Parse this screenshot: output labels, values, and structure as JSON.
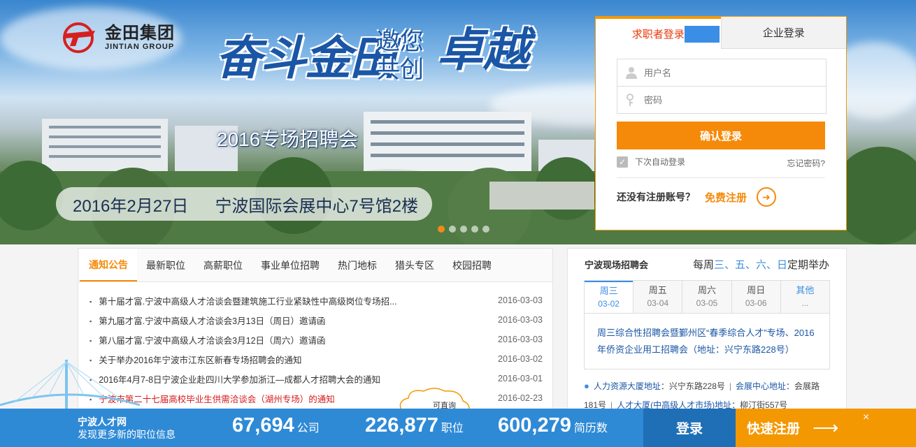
{
  "banner": {
    "logo_cn": "金田集团",
    "logo_en": "JINTIAN GROUP",
    "slogan_big": "奋斗金田",
    "slogan_line1": "邀您",
    "slogan_line2": "共创",
    "slogan_zy": "卓越",
    "fair_title": "2016专场招聘会",
    "date": "2016年2月27日",
    "venue": "宁波国际会展中心7号馆2楼"
  },
  "login": {
    "tab_seeker": "求职者登录",
    "tab_company": "企业登录",
    "username_placeholder": "用户名",
    "password_placeholder": "密码",
    "submit": "确认登录",
    "remember": "下次自动登录",
    "forgot": "忘记密码?",
    "no_account": "还没有注册账号？",
    "free_register": "免费注册"
  },
  "notice": {
    "tabs": [
      "通知公告",
      "最新职位",
      "高薪职位",
      "事业单位招聘",
      "热门地标",
      "猎头专区",
      "校园招聘"
    ],
    "items": [
      {
        "title": "第十届才富.宁波中高级人才洽谈会暨建筑施工行业紧缺性中高级岗位专场招...",
        "date": "2016-03-03"
      },
      {
        "title": "第九届才富.宁波中高级人才洽谈会3月13日（周日）邀请函",
        "date": "2016-03-03"
      },
      {
        "title": "第八届才富.宁波中高级人才洽谈会3月12日（周六）邀请函",
        "date": "2016-03-03"
      },
      {
        "title": "关于举办2016年宁波市江东区新春专场招聘会的通知",
        "date": "2016-03-02"
      },
      {
        "title": "2016年4月7-8日宁波企业赴四川大学参加浙江—成都人才招聘大会的通知",
        "date": "2016-03-01"
      },
      {
        "title": "宁波市第二十七届高校毕业生供需洽谈会（湖州专场）的通知",
        "date": "2016-02-23"
      }
    ],
    "bubble": "可直询"
  },
  "fair": {
    "title": "宁波现场招聘会",
    "schedule_prefix": "每周",
    "schedule_days": "三、五、六、日",
    "schedule_suffix": "定期举办",
    "days": [
      {
        "name": "周三",
        "date": "03-02"
      },
      {
        "name": "周五",
        "date": "03-04"
      },
      {
        "name": "周六",
        "date": "03-05"
      },
      {
        "name": "周日",
        "date": "03-06"
      },
      {
        "name": "其他",
        "date": "..."
      }
    ],
    "desc": "周三综合性招聘会暨鄞州区“春季综合人才”专场、2016年侨资企业用工招聘会（地址：兴宁东路228号）",
    "addr1_label": "人力资源大厦地址",
    "addr1_value": "：兴宁东路228号",
    "addr2_label": "会展中心地址",
    "addr2_value": "：会展路181号",
    "addr3_label": "人才大厦(中高级人才市场)地址",
    "addr3_value": "：柳汀街557号"
  },
  "bottom": {
    "brand_name": "宁波人才网",
    "brand_slogan": "发现更多新的职位信息",
    "companies": "67,694",
    "companies_unit": "公司",
    "jobs": "226,877",
    "jobs_unit": "职位",
    "resumes": "600,279",
    "resumes_unit": "简历数",
    "login": "登录",
    "register": "快速注册",
    "close": "×"
  },
  "colors": {
    "accent_orange": "#f58a0a",
    "accent_blue": "#2f8ad6",
    "link_blue": "#1a56a5",
    "alert_red": "#d61a1a"
  }
}
